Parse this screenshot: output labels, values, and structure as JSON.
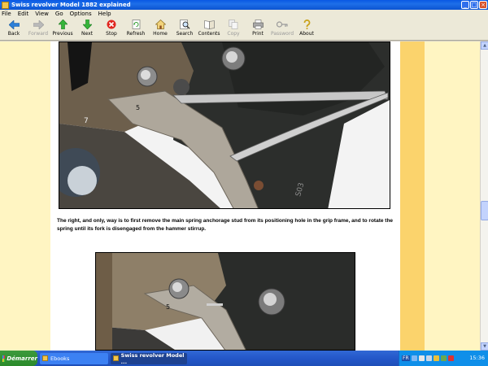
{
  "window": {
    "title": "Swiss revolver Model 1882 explained"
  },
  "menu": [
    "File",
    "Edit",
    "View",
    "Go",
    "Options",
    "Help"
  ],
  "toolbar": [
    {
      "label": "Back",
      "icon": "back-arrow-icon",
      "enabled": true
    },
    {
      "label": "Forward",
      "icon": "forward-arrow-icon",
      "enabled": false
    },
    {
      "label": "Previous",
      "icon": "up-arrow-icon",
      "enabled": true
    },
    {
      "label": "Next",
      "icon": "down-arrow-icon",
      "enabled": true
    },
    {
      "label": "Stop",
      "icon": "stop-icon",
      "enabled": true
    },
    {
      "label": "Refresh",
      "icon": "refresh-icon",
      "enabled": true
    },
    {
      "label": "Home",
      "icon": "home-icon",
      "enabled": true
    },
    {
      "label": "Search",
      "icon": "search-icon",
      "enabled": true
    },
    {
      "label": "Contents",
      "icon": "contents-icon",
      "enabled": true
    },
    {
      "label": "Copy",
      "icon": "copy-icon",
      "enabled": false
    },
    {
      "label": "Print",
      "icon": "print-icon",
      "enabled": true
    },
    {
      "label": "Password",
      "icon": "key-icon",
      "enabled": false
    },
    {
      "label": "About",
      "icon": "about-icon",
      "enabled": true
    }
  ],
  "content": {
    "paragraph": "The right, and only, way is to first remove the main spring anchorage stud from its positioning hole in the grip frame, and to rotate the spring until its fork is disengaged from the hammer stirrup.",
    "photo1_marks": {
      "part_number": "5",
      "number_left": "7"
    },
    "photo2_marks": {
      "part_number": "5"
    }
  },
  "taskbar": {
    "start_label": "Démarrer",
    "tasks": [
      {
        "label": "Ebooks",
        "active": false
      },
      {
        "label": "Swiss revolver Model ...",
        "active": true
      }
    ],
    "tray_lang": "FR",
    "clock": "15:36"
  },
  "colors": {
    "page_bg": "#ffffff",
    "side_light": "#fff5c2",
    "side_dark": "#fbd36c",
    "title_bar": "#0a58e4",
    "taskbar": "#2457c9"
  }
}
